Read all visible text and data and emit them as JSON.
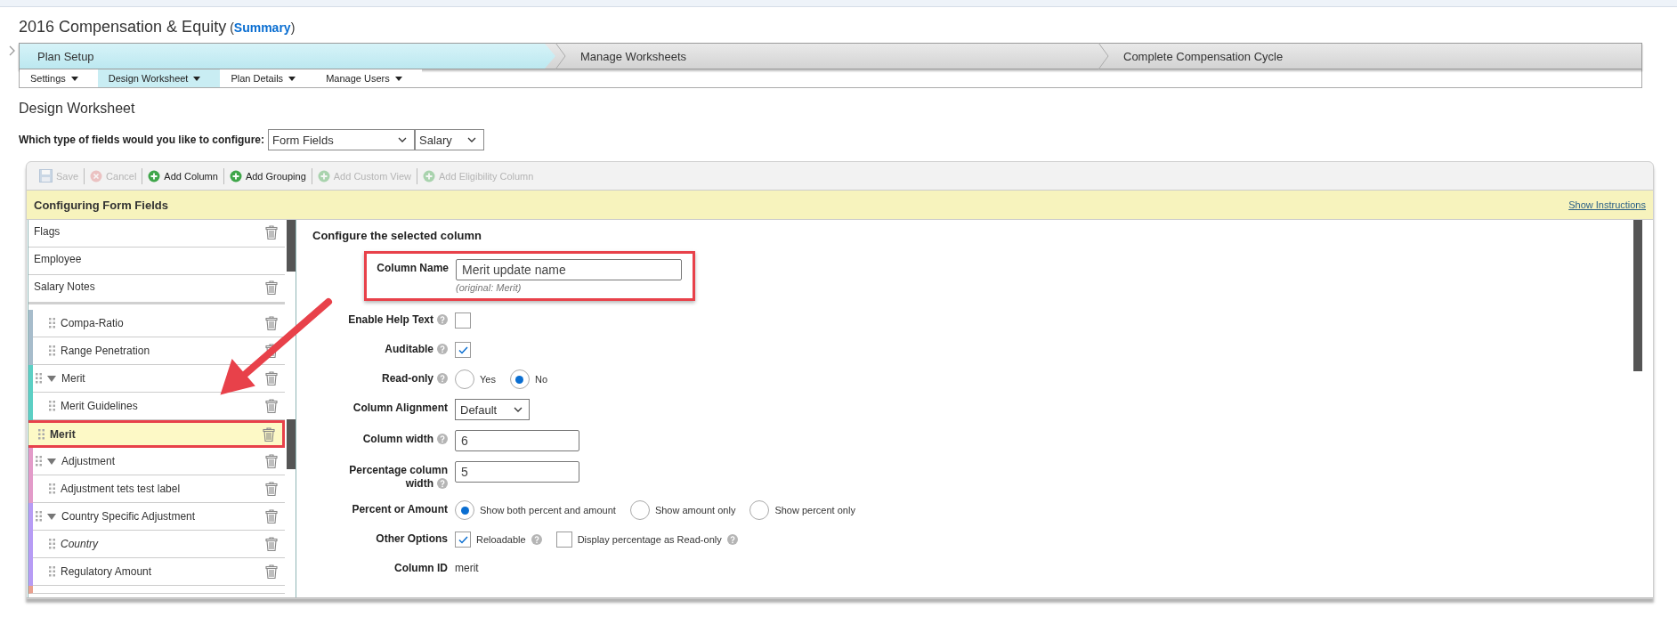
{
  "header": {
    "title": "2016 Compensation & Equity",
    "link_open": "(",
    "link": "Summary",
    "link_close": ")"
  },
  "steps": [
    {
      "label": "Plan Setup",
      "selected": true
    },
    {
      "label": "Manage Worksheets",
      "selected": false
    },
    {
      "label": "Complete Compensation Cycle",
      "selected": false
    }
  ],
  "subtabs": [
    {
      "label": "Settings",
      "selected": false
    },
    {
      "label": "Design Worksheet",
      "selected": true
    },
    {
      "label": "Plan Details",
      "selected": false
    },
    {
      "label": "Manage Users",
      "selected": false
    }
  ],
  "page_heading": "Design Worksheet",
  "field_type": {
    "label": "Which type of fields would you like to configure:",
    "selects": [
      {
        "value": "Form Fields"
      },
      {
        "value": "Salary"
      }
    ]
  },
  "toolbar": [
    {
      "label": "Save",
      "kind": "save",
      "disabled": true
    },
    {
      "label": "Cancel",
      "kind": "cancel",
      "disabled": true
    },
    {
      "label": "Add Column",
      "kind": "add",
      "disabled": false
    },
    {
      "label": "Add Grouping",
      "kind": "add",
      "disabled": false
    },
    {
      "label": "Add Custom View",
      "kind": "add",
      "disabled": true
    },
    {
      "label": "Add Eligibility Column",
      "kind": "add",
      "disabled": true
    }
  ],
  "panel": {
    "title": "Configuring Form Fields",
    "link": "Show Instructions"
  },
  "columns": {
    "pinned": [
      {
        "label": "Flags",
        "deletable": true
      },
      {
        "label": "Employee",
        "deletable": false
      },
      {
        "label": "Salary Notes",
        "deletable": true
      }
    ],
    "groups": [
      {
        "color": "#a7bccb",
        "children": [
          {
            "label": "Compa-Ratio",
            "italic": false,
            "selected": false,
            "highlighted": false
          },
          {
            "label": "Range Penetration",
            "italic": false,
            "selected": false,
            "highlighted": false
          }
        ]
      },
      {
        "label": "Merit",
        "expanded": true,
        "color": "#5ccfc4",
        "children": [
          {
            "label": "Merit Guidelines",
            "italic": false,
            "selected": false,
            "highlighted": false
          },
          {
            "label": "Merit",
            "italic": false,
            "selected": true,
            "highlighted": true
          }
        ]
      },
      {
        "label": "Adjustment",
        "expanded": true,
        "color": "#e39bc9",
        "children": [
          {
            "label": "Adjustment tets test label",
            "italic": false,
            "selected": false,
            "highlighted": false
          }
        ]
      },
      {
        "label": "Country Specific Adjustment",
        "expanded": true,
        "color": "#b79cf5",
        "children": [
          {
            "label": "Country",
            "italic": true,
            "selected": false,
            "highlighted": false
          },
          {
            "label": "Regulatory Amount",
            "italic": false,
            "selected": false,
            "highlighted": false
          }
        ]
      }
    ]
  },
  "form": {
    "title": "Configure the selected column",
    "rows": [
      {
        "kind": "text",
        "label": "Column Name",
        "help": false,
        "highlighted": true,
        "value": "Merit update name",
        "note": "(original: Merit)"
      },
      {
        "kind": "checkbox",
        "label": "Enable Help Text",
        "help": true,
        "highlighted": false,
        "options": [
          {
            "checked": false
          }
        ]
      },
      {
        "kind": "checkbox",
        "label": "Auditable",
        "help": true,
        "highlighted": false,
        "options": [
          {
            "checked": true
          }
        ]
      },
      {
        "kind": "radio",
        "label": "Read-only",
        "help": true,
        "highlighted": false,
        "options": [
          {
            "label": "Yes",
            "selected": false
          },
          {
            "label": "No",
            "selected": true
          }
        ]
      },
      {
        "kind": "select",
        "label": "Column Alignment",
        "help": false,
        "highlighted": false,
        "value": "Default"
      },
      {
        "kind": "text",
        "label": "Column width",
        "help": true,
        "highlighted": false,
        "value": "6"
      },
      {
        "kind": "text",
        "label": "Percentage column width",
        "help": true,
        "highlighted": false,
        "value": "5"
      },
      {
        "kind": "radio",
        "label": "Percent or Amount",
        "help": false,
        "highlighted": false,
        "options": [
          {
            "label": "Show both percent and amount",
            "selected": true
          },
          {
            "label": "Show amount only",
            "selected": false
          },
          {
            "label": "Show percent only",
            "selected": false
          }
        ]
      },
      {
        "kind": "checkbox",
        "label": "Other Options",
        "help": false,
        "highlighted": false,
        "options": [
          {
            "label": "Reloadable",
            "checked": true,
            "help": true
          },
          {
            "label": "Display percentage as Read-only",
            "checked": false,
            "help": true
          }
        ]
      },
      {
        "kind": "static",
        "label": "Column ID",
        "help": false,
        "highlighted": false,
        "value": "merit"
      }
    ]
  }
}
